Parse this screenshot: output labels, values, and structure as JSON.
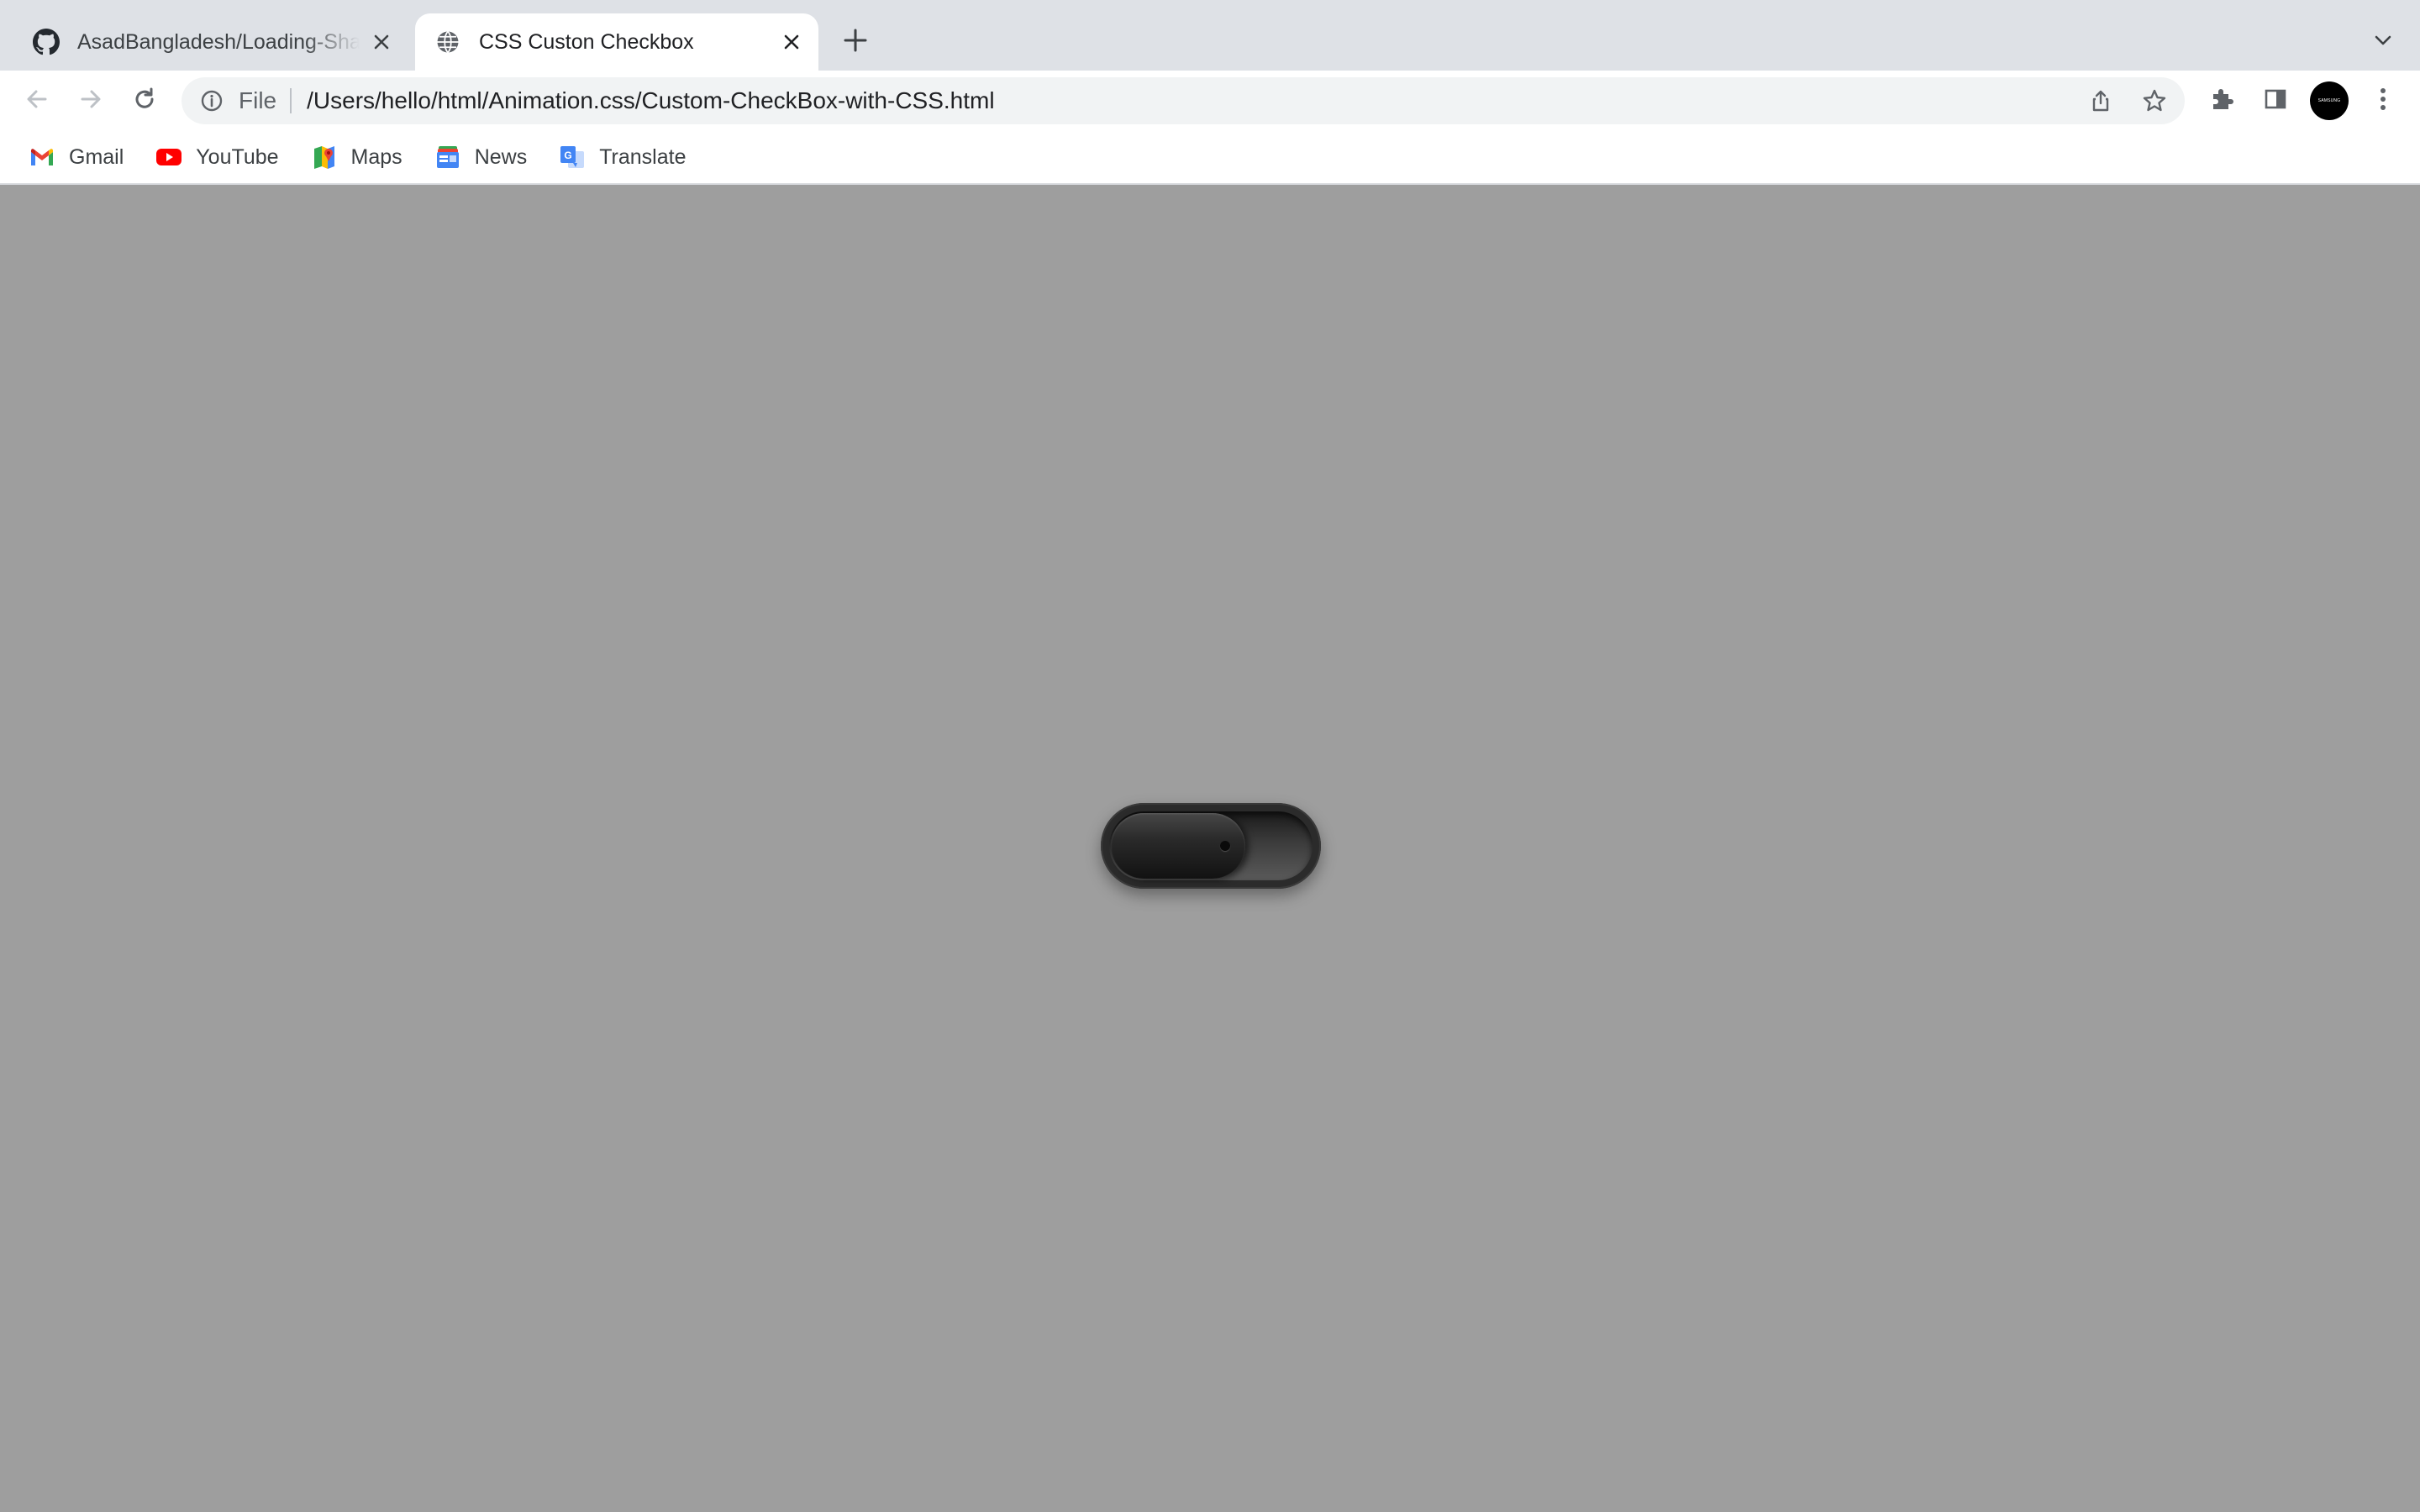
{
  "tabs": [
    {
      "title": "AsadBangladesh/Loading-Shadow",
      "icon": "github-icon",
      "active": false
    },
    {
      "title": "CSS Custon Checkbox",
      "icon": "globe-icon",
      "active": true
    }
  ],
  "toolbar": {
    "scheme_label": "File",
    "url": "/Users/hello/html/Animation.css/Custom-CheckBox-with-CSS.html",
    "avatar_text": "SAMSUNG"
  },
  "bookmarks": [
    {
      "label": "Gmail",
      "icon": "gmail-icon"
    },
    {
      "label": "YouTube",
      "icon": "youtube-icon"
    },
    {
      "label": "Maps",
      "icon": "maps-icon"
    },
    {
      "label": "News",
      "icon": "news-icon"
    },
    {
      "label": "Translate",
      "icon": "translate-icon"
    }
  ],
  "page": {
    "background_color": "#9e9e9e",
    "checkbox_checked": false
  },
  "colors": {
    "tabstrip": "#dee1e6",
    "omnibox": "#f1f3f4",
    "toggle_body": "#2b2b2b"
  }
}
